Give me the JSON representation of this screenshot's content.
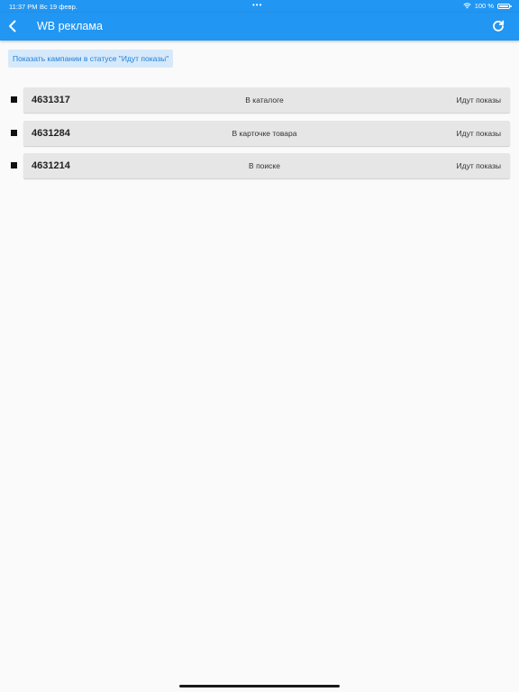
{
  "status_bar": {
    "time": "11:37 PM",
    "date": "Вс 19 февр.",
    "dots": "•••",
    "battery": "100 %"
  },
  "app_bar": {
    "title": "WB реклама",
    "back_icon": "chevron-left-icon",
    "refresh_icon": "refresh-icon",
    "color": "#2196f3"
  },
  "filter_button": {
    "label": "Показать кампании в статусе \"Идут показы\""
  },
  "campaigns": [
    {
      "id": "4631317",
      "type": "В каталоге",
      "status": "Идут показы"
    },
    {
      "id": "4631284",
      "type": "В карточке товара",
      "status": "Идут показы"
    },
    {
      "id": "4631214",
      "type": "В поиске",
      "status": "Идут показы"
    }
  ]
}
